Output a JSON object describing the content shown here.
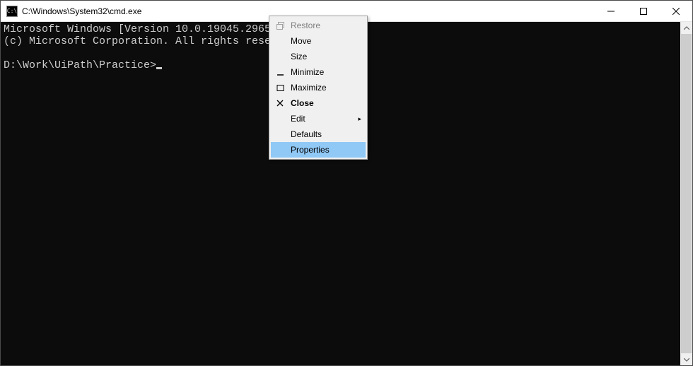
{
  "titlebar": {
    "title": "C:\\Windows\\System32\\cmd.exe",
    "minimize_label": "Minimize",
    "maximize_label": "Maximize",
    "close_label": "Close"
  },
  "console": {
    "line1": "Microsoft Windows [Version 10.0.19045.2965]",
    "line2": "(c) Microsoft Corporation. All rights reserved.",
    "blank": "",
    "prompt": "D:\\Work\\UiPath\\Practice>"
  },
  "menu": {
    "restore": "Restore",
    "move": "Move",
    "size": "Size",
    "minimize": "Minimize",
    "maximize": "Maximize",
    "close": "Close",
    "edit": "Edit",
    "defaults": "Defaults",
    "properties": "Properties"
  }
}
